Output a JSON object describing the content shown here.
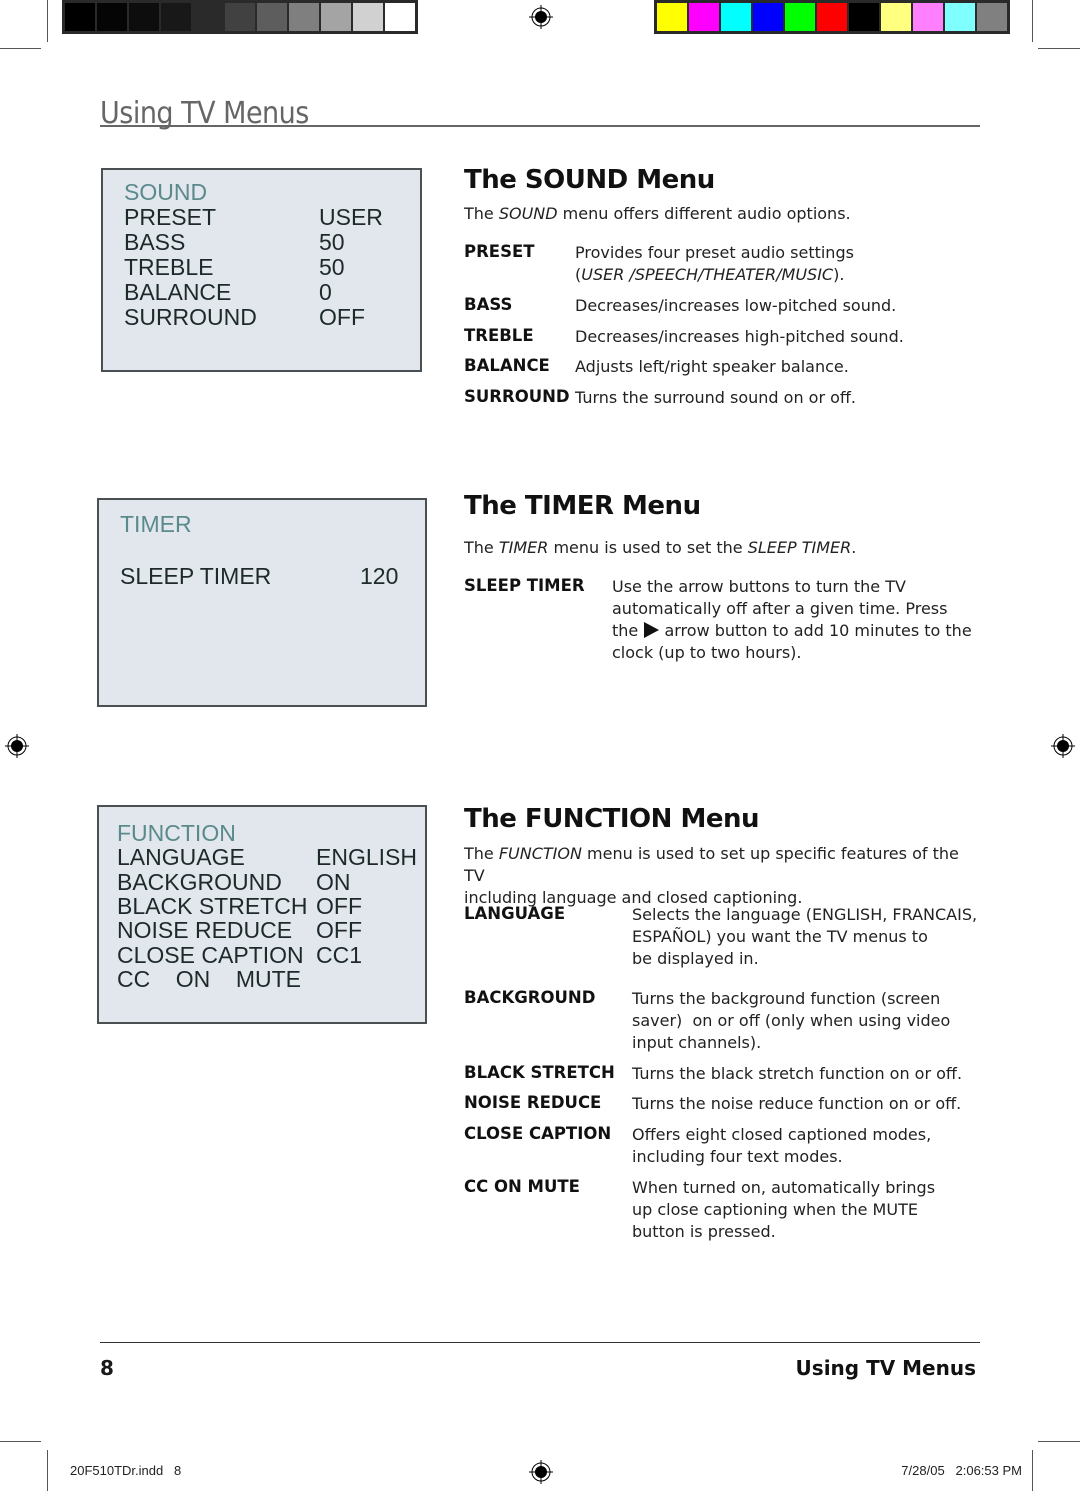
{
  "print_marks": {
    "gray_bar": [
      "#000000",
      "#050505",
      "#0d0d0d",
      "#181818",
      "#2a2a2a",
      "#414141",
      "#5d5d5d",
      "#7f7f7f",
      "#a4a4a4",
      "#d1d1d1",
      "#ffffff"
    ],
    "color_bar": [
      "#ffff00",
      "#ff00ff",
      "#00ffff",
      "#0000ff",
      "#00ff00",
      "#ff0000",
      "#000000",
      "#ffff80",
      "#ff80ff",
      "#80ffff",
      "#808080"
    ]
  },
  "header": {
    "title": "Using TV Menus"
  },
  "sound": {
    "osd": {
      "title": "SOUND",
      "rows": [
        {
          "label": "PRESET",
          "value": "USER"
        },
        {
          "label": "BASS",
          "value": "50"
        },
        {
          "label": "TREBLE",
          "value": "50"
        },
        {
          "label": "BALANCE",
          "value": "0"
        },
        {
          "label": "SURROUND",
          "value": "OFF"
        }
      ]
    },
    "heading": "The SOUND Menu",
    "intro_pre": "The ",
    "intro_em": "SOUND",
    "intro_post": " menu offers different audio options.",
    "items": [
      {
        "term": "PRESET",
        "desc": "Provides four preset audio settings",
        "desc2_pre": "(",
        "desc2_em": "USER /SPEECH/THEATER/MUSIC",
        "desc2_post": ")."
      },
      {
        "term": "BASS",
        "desc": "Decreases/increases low-pitched sound."
      },
      {
        "term": "TREBLE",
        "desc": "Decreases/increases high-pitched sound."
      },
      {
        "term": "BALANCE",
        "desc": "Adjusts left/right speaker balance."
      },
      {
        "term": "SURROUND",
        "desc": "Turns the surround sound on or off."
      }
    ]
  },
  "timer": {
    "osd": {
      "title": "TIMER",
      "rows": [
        {
          "label": "SLEEP TIMER",
          "value": "120"
        }
      ]
    },
    "heading": "The TIMER Menu",
    "intro_pre": "The ",
    "intro_em": "TIMER",
    "intro_mid": " menu is used to set the ",
    "intro_em2": "SLEEP TIMER",
    "intro_post": ".",
    "items": [
      {
        "term": "SLEEP TIMER",
        "line1": "Use the arrow buttons to turn the TV",
        "line2": "automatically off after a given time. Press",
        "line3_pre": "the",
        "line3_post": "arrow button to add 10 minutes to the",
        "line4": "clock (up to two hours)."
      }
    ]
  },
  "function": {
    "osd": {
      "title": "FUNCTION",
      "rows": [
        {
          "label": "LANGUAGE",
          "value": "ENGLISH"
        },
        {
          "label": "BACKGROUND",
          "value": "ON"
        },
        {
          "label": "BLACK STRETCH",
          "value": "OFF"
        },
        {
          "label": "NOISE REDUCE",
          "value": "OFF"
        },
        {
          "label": "CLOSE CAPTION",
          "value": "CC1"
        },
        {
          "label": "CC    ON    MUTE",
          "value": ""
        }
      ]
    },
    "heading": "The FUNCTION Menu",
    "intro_pre": "The ",
    "intro_em": "FUNCTION",
    "intro_post": " menu is used to set up specific features of the TV",
    "intro_line2": "including language and closed captioning.",
    "items": [
      {
        "term": "LANGUAGE",
        "lines": [
          "Selects the language (ENGLISH, FRANCAIS,",
          "ESPAÑOL) you want the TV menus to",
          "be displayed in."
        ]
      },
      {
        "term": "BACKGROUND",
        "lines": [
          "Turns the background function (screen",
          "saver)  on or off (only when using video",
          "input channels)."
        ]
      },
      {
        "term": "BLACK STRETCH",
        "lines": [
          "Turns the black stretch function on or off."
        ]
      },
      {
        "term": "NOISE REDUCE",
        "lines": [
          "Turns the noise reduce function on or off."
        ]
      },
      {
        "term": "CLOSE CAPTION",
        "lines": [
          "Offers eight closed captioned modes,",
          "including four text modes."
        ]
      },
      {
        "term": "CC ON MUTE",
        "lines": [
          "When turned on, automatically brings",
          "up close captioning when the MUTE",
          "button is pressed."
        ]
      }
    ]
  },
  "footer": {
    "page_number": "8",
    "section_title": "Using TV Menus",
    "slug_file": "20F510TDr.indd   8",
    "slug_date": "7/28/05   2:06:53 PM"
  }
}
